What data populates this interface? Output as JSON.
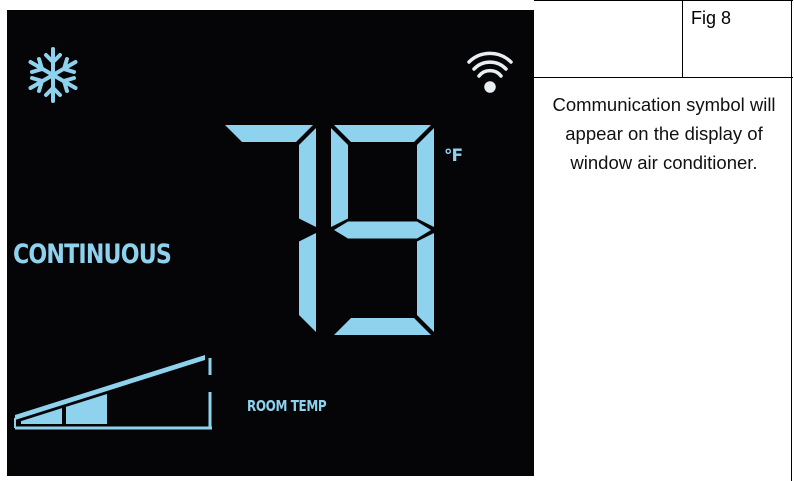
{
  "display": {
    "temperature": "79",
    "unit": "°F",
    "mode": "CONTINUOUS",
    "room_label": "ROOM TEMP",
    "fan_speed_level": 2,
    "fan_speed_max": 4,
    "icons": [
      "snowflake-icon",
      "wifi-icon"
    ],
    "colors": {
      "segment": "#8fd2ee",
      "background": "#050508"
    }
  },
  "caption": {
    "figure_label": "Fig 8",
    "text": "Communication symbol will appear on the display of window air conditioner."
  }
}
